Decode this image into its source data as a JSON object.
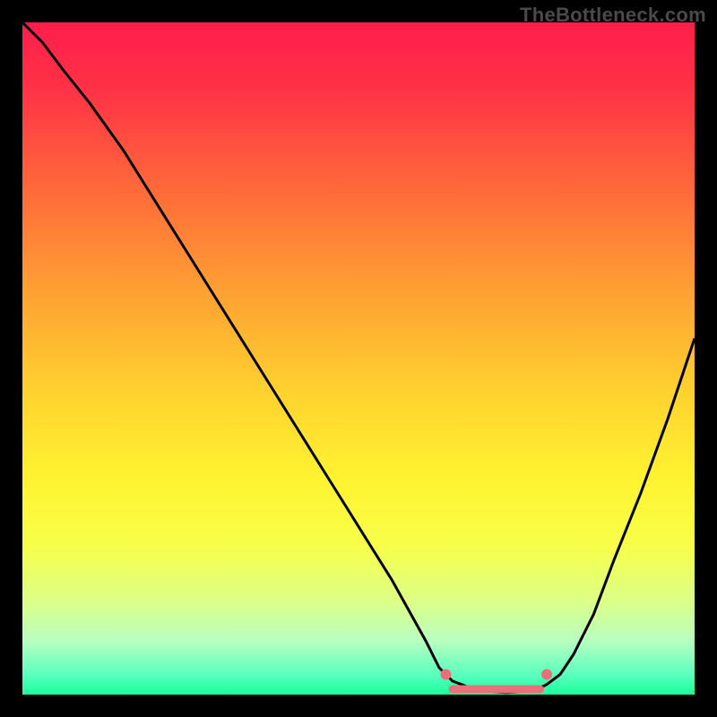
{
  "watermark": "TheBottleneck.com",
  "chart_data": {
    "type": "line",
    "title": "",
    "xlabel": "",
    "ylabel": "",
    "xlim": [
      0,
      100
    ],
    "ylim": [
      0,
      100
    ],
    "gradient_stops": [
      {
        "offset": 0.0,
        "color": "#ff1e4b"
      },
      {
        "offset": 0.1,
        "color": "#ff3246"
      },
      {
        "offset": 0.25,
        "color": "#ff6a3a"
      },
      {
        "offset": 0.4,
        "color": "#ffa033"
      },
      {
        "offset": 0.55,
        "color": "#ffd22f"
      },
      {
        "offset": 0.68,
        "color": "#fff330"
      },
      {
        "offset": 0.78,
        "color": "#f7ff4a"
      },
      {
        "offset": 0.86,
        "color": "#ddff86"
      },
      {
        "offset": 0.92,
        "color": "#b7ffc0"
      },
      {
        "offset": 0.97,
        "color": "#5bffbe"
      },
      {
        "offset": 1.0,
        "color": "#1bff9e"
      }
    ],
    "series": [
      {
        "name": "bottleneck-curve",
        "color": "#000000",
        "x": [
          0,
          3,
          6,
          10,
          15,
          20,
          25,
          30,
          35,
          40,
          45,
          50,
          55,
          60,
          62,
          64,
          68,
          72,
          76,
          78,
          80,
          82,
          85,
          88,
          92,
          96,
          100
        ],
        "y": [
          100,
          97,
          93,
          88,
          81,
          73,
          65,
          57,
          49,
          41,
          33,
          25,
          17,
          8,
          4,
          2,
          0.5,
          0.3,
          0.5,
          1.5,
          3,
          6,
          12,
          20,
          30,
          41,
          53
        ]
      }
    ],
    "markers": [
      {
        "name": "optimal-range-start-dot",
        "x": 63,
        "y": 3,
        "color": "#e9707a",
        "r": 6
      },
      {
        "name": "optimal-range-end-dot",
        "x": 78,
        "y": 3,
        "color": "#e9707a",
        "r": 6
      }
    ],
    "optimal_band": {
      "x_start": 64,
      "x_end": 77,
      "y": 0.8,
      "color": "#e9707a",
      "thickness": 9
    }
  }
}
